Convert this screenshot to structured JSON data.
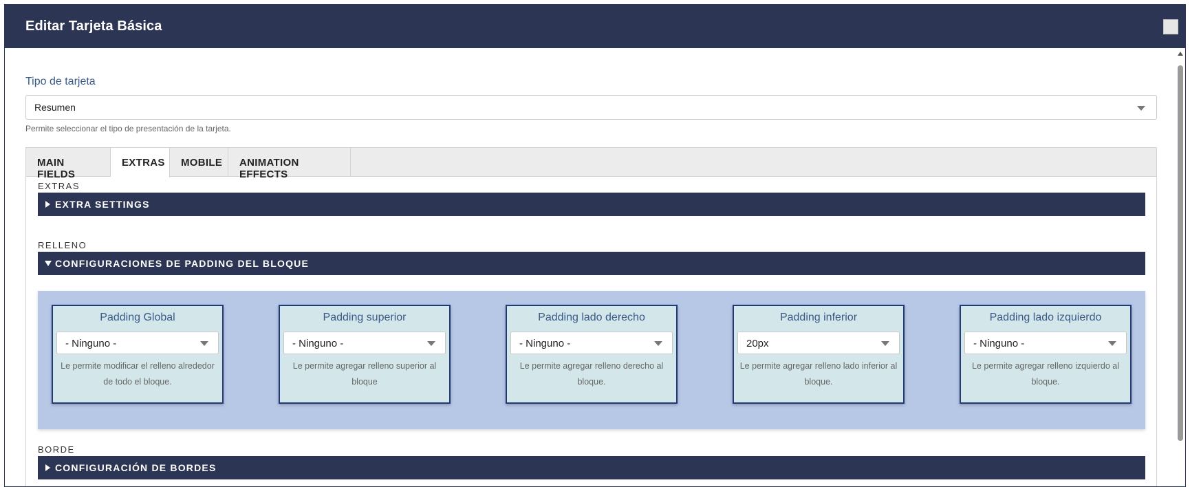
{
  "dialog": {
    "title": "Editar Tarjeta Básica"
  },
  "card_type": {
    "label": "Tipo de tarjeta",
    "value": "Resumen",
    "help": "Permite seleccionar el tipo de presentación de la tarjeta."
  },
  "tabs": [
    {
      "label": "MAIN FIELDS"
    },
    {
      "label": "EXTRAS"
    },
    {
      "label": "MOBILE"
    },
    {
      "label": "ANIMATION EFFECTS"
    }
  ],
  "active_tab": "EXTRAS",
  "sections": {
    "extras": {
      "label": "EXTRAS",
      "bar": "EXTRA SETTINGS",
      "expanded": false
    },
    "relleno": {
      "label": "RELLENO",
      "bar": "CONFIGURACIONES DE PADDING DEL BLOQUE",
      "expanded": true
    },
    "borde": {
      "label": "BORDE",
      "bar": "CONFIGURACIÓN DE BORDES",
      "expanded": false
    }
  },
  "padding_cards": [
    {
      "title": "Padding Global",
      "value": "- Ninguno -",
      "help": "Le permite modificar el relleno alrededor de todo el bloque."
    },
    {
      "title": "Padding superior",
      "value": "- Ninguno -",
      "help": "Le permite agregar relleno superior al bloque"
    },
    {
      "title": "Padding lado derecho",
      "value": "- Ninguno -",
      "help": "Le permite agregar relleno derecho al bloque."
    },
    {
      "title": "Padding inferior",
      "value": "20px",
      "help": "Le permite agregar relleno lado inferior al bloque."
    },
    {
      "title": "Padding lado izquierdo",
      "value": "- Ninguno -",
      "help": "Le permite agregar relleno izquierdo al bloque."
    }
  ],
  "icons": {
    "close": "close-icon",
    "dropdown": "chevron-down-icon",
    "collapsed": "triangle-right-icon",
    "expanded": "triangle-down-icon"
  },
  "colors": {
    "header_bg": "#2c3654",
    "panel_bg": "#b7c7e6",
    "card_bg": "#d3e6e9",
    "card_border": "#1f3a78",
    "label_text": "#3a5a8a"
  }
}
